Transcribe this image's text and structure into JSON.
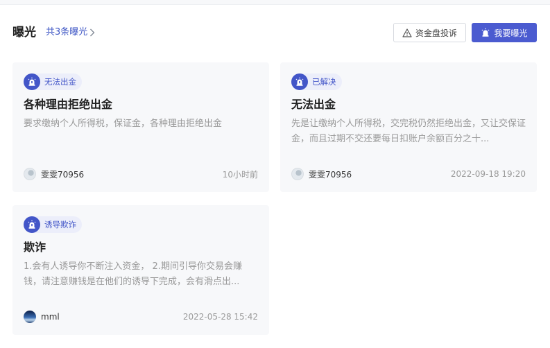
{
  "header": {
    "title": "曝光",
    "count_text": "共3条曝光",
    "complaint_button": "资金盘投诉",
    "expose_button": "我要曝光"
  },
  "colors": {
    "accent": "#4b5bd0",
    "tag_bg": "#eceefa",
    "card_bg": "#f7f8fa",
    "muted_text": "#999999"
  },
  "cards": [
    {
      "tag": "无法出金",
      "title": "各种理由拒绝出金",
      "desc": "要求缴纳个人所得税，保证金，各种理由拒绝出金",
      "user": "雯雯70956",
      "avatar": "gray-avatar",
      "time": "10小时前"
    },
    {
      "tag": "已解决",
      "title": "无法出金",
      "desc": "先是让缴纳个人所得税，交完税仍然拒绝出金，又让交保证金，而且过期不交还要每日扣账户余额百分之十...",
      "user": "雯雯70956",
      "avatar": "gray-avatar",
      "time": "2022-09-18 19:20"
    },
    {
      "tag": "诱导欺诈",
      "title": "欺诈",
      "desc": "1.会有人诱导你不断注入资金， 2.期间引导你交易会赚钱，请注意赚钱是在他们的诱导下完成，会有滑点出...",
      "user": "mml",
      "avatar": "blue-avatar",
      "time": "2022-05-28 15:42"
    }
  ]
}
